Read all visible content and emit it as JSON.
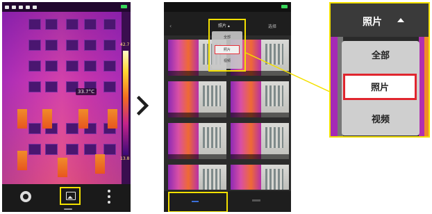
{
  "left_screen": {
    "temperature_readout": "33.7°C",
    "scale_max": "42.7",
    "scale_min": "13.8",
    "toolbar": {
      "settings_icon": "gear-icon",
      "gallery_icon": "image-icon",
      "more_icon": "more-vertical-icon"
    }
  },
  "arrow_icon": "chevron-right-icon",
  "gallery_screen": {
    "dropdown_title": "照片 ▴",
    "select_label": "选择",
    "menu_items": [
      "全部",
      "照片",
      "视频"
    ],
    "selected_item": "照片"
  },
  "zoom_callout": {
    "title": "照片",
    "menu_items": [
      "全部",
      "照片",
      "视频"
    ],
    "selected_item": "照片"
  },
  "colors": {
    "highlight": "#f3e000",
    "selection": "#e0252e"
  }
}
